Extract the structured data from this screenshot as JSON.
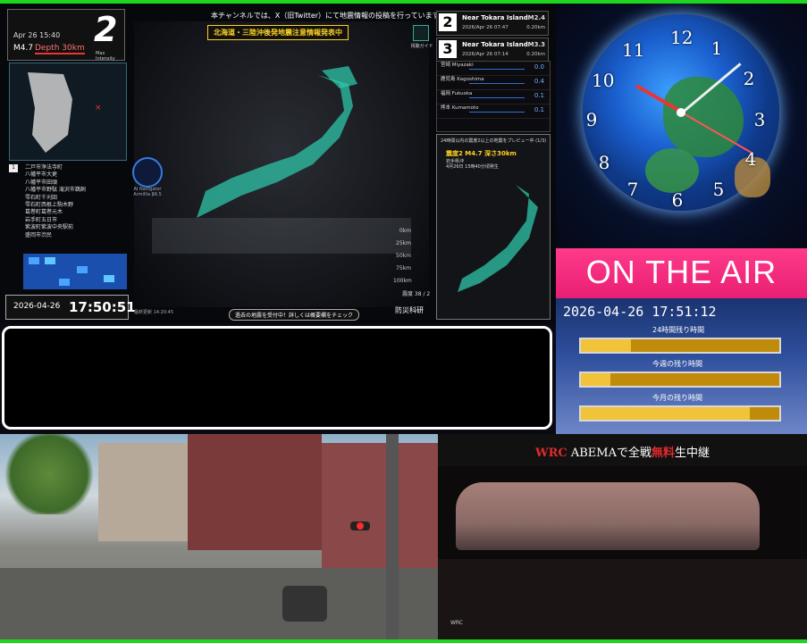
{
  "quake_monitor": {
    "intensity": {
      "date": "Apr 26 15:40",
      "magnitude": "M4.7",
      "depth": "Depth 30km",
      "value": "2",
      "label": "Max Intensity"
    },
    "top_notice": "本チャンネルでは、X（旧Twitter）にて地震情報の投稿を行っています。",
    "alert_banner": "北海道・三陸沖後発地震注意情報発表中",
    "city_rank": "1",
    "cities": [
      "二戸市浄法寺町",
      "八幡平市大更",
      "八幡平市田頭",
      "八幡平市野駄 滝沢市鵜飼",
      "雫石町千刈田",
      "雫石町西根上駒木野",
      "葛巻町葛巻元木",
      "岩手町五日市",
      "紫波町紫波中央駅前",
      "盛岡市渋民"
    ],
    "clock": {
      "date": "2026-04-26",
      "time": "17:50:51"
    },
    "ai_navigator": "AI Navigator Armillia β6.5",
    "depth_scale": [
      "0km",
      "25km",
      "50km",
      "75km",
      "100km"
    ],
    "bottom_button": "過去の地震を受付中！詳しくは概要欄をチェック",
    "record_time": "最終更新 14:20:45",
    "provider": "防災科研",
    "stat": "震度 38 / 2",
    "guide_label": "視聴ガイド",
    "quake_list": [
      {
        "num": "2",
        "location": "Near Tokara Island",
        "date": "2026/Apr 26 07:47",
        "mag": "M2.4",
        "depth": "0.20km"
      },
      {
        "num": "3",
        "location": "Near Tokara Island",
        "date": "2026/Apr 26 07:14",
        "mag": "M3.3",
        "depth": "0.20km"
      }
    ],
    "stations": [
      {
        "name": "宮崎 Miyazaki",
        "value": "0.0"
      },
      {
        "name": "鹿児島 Kagoshima",
        "value": "0.4"
      },
      {
        "name": "福岡 Fukuoka",
        "value": "0.1"
      },
      {
        "name": "熊本 Kumamoto",
        "value": "0.1"
      }
    ],
    "preview": {
      "header": "24時間以内の震度2以上の地震をプレビュー中 (1/3)",
      "title": "震度2 M4.7 深さ30km",
      "region": "岩手県沖",
      "time": "4月26日 15時40分頃発生"
    }
  },
  "clock_panel": {
    "numerals": [
      "12",
      "1",
      "2",
      "3",
      "4",
      "5",
      "6",
      "7",
      "8",
      "9",
      "10",
      "11"
    ],
    "on_air": "ON THE AIR",
    "timestamp": "2026-04-26 17:51:12",
    "bars": [
      {
        "label": "24時間残り時間",
        "fill": 0.25
      },
      {
        "label": "今週の残り時間",
        "fill": 0.15
      },
      {
        "label": "今月の残り時間",
        "fill": 0.85
      }
    ]
  },
  "rally": {
    "title_prefix": "WRC",
    "title_mid": " ABEMAで全戦",
    "title_red": "無料",
    "title_end": "生中継",
    "logo": "WRC"
  }
}
